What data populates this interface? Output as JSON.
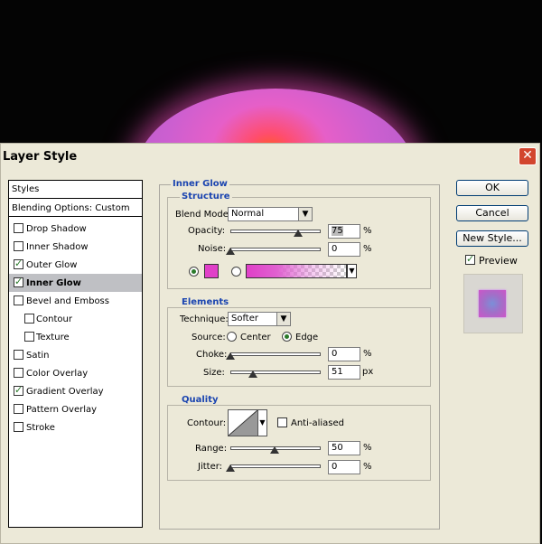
{
  "dialog": {
    "title": "Layer Style"
  },
  "styles_panel": {
    "header": "Styles",
    "blending": "Blending Options: Custom",
    "items": [
      {
        "label": "Drop Shadow",
        "checked": false
      },
      {
        "label": "Inner Shadow",
        "checked": false
      },
      {
        "label": "Outer Glow",
        "checked": true
      },
      {
        "label": "Inner Glow",
        "checked": true,
        "selected": true
      },
      {
        "label": "Bevel and Emboss",
        "checked": false
      },
      {
        "label": "Contour",
        "checked": false
      },
      {
        "label": "Texture",
        "checked": false
      },
      {
        "label": "Satin",
        "checked": false
      },
      {
        "label": "Color Overlay",
        "checked": false
      },
      {
        "label": "Gradient Overlay",
        "checked": true
      },
      {
        "label": "Pattern Overlay",
        "checked": false
      },
      {
        "label": "Stroke",
        "checked": false
      }
    ]
  },
  "inner_glow": {
    "title": "Inner Glow",
    "structure": {
      "title": "Structure",
      "blend_mode_label": "Blend Mode:",
      "blend_mode_value": "Normal",
      "opacity_label": "Opacity:",
      "opacity_value": "75",
      "opacity_unit": "%",
      "noise_label": "Noise:",
      "noise_value": "0",
      "noise_unit": "%",
      "glow_color": "#e040c8"
    },
    "elements": {
      "title": "Elements",
      "technique_label": "Technique:",
      "technique_value": "Softer",
      "source_label": "Source:",
      "source_center": "Center",
      "source_edge": "Edge",
      "choke_label": "Choke:",
      "choke_value": "0",
      "choke_unit": "%",
      "size_label": "Size:",
      "size_value": "51",
      "size_unit": "px"
    },
    "quality": {
      "title": "Quality",
      "contour_label": "Contour:",
      "anti_aliased_label": "Anti-aliased",
      "range_label": "Range:",
      "range_value": "50",
      "range_unit": "%",
      "jitter_label": "Jitter:",
      "jitter_value": "0",
      "jitter_unit": "%"
    }
  },
  "buttons": {
    "ok": "OK",
    "cancel": "Cancel",
    "new_style": "New Style...",
    "preview_label": "Preview"
  }
}
